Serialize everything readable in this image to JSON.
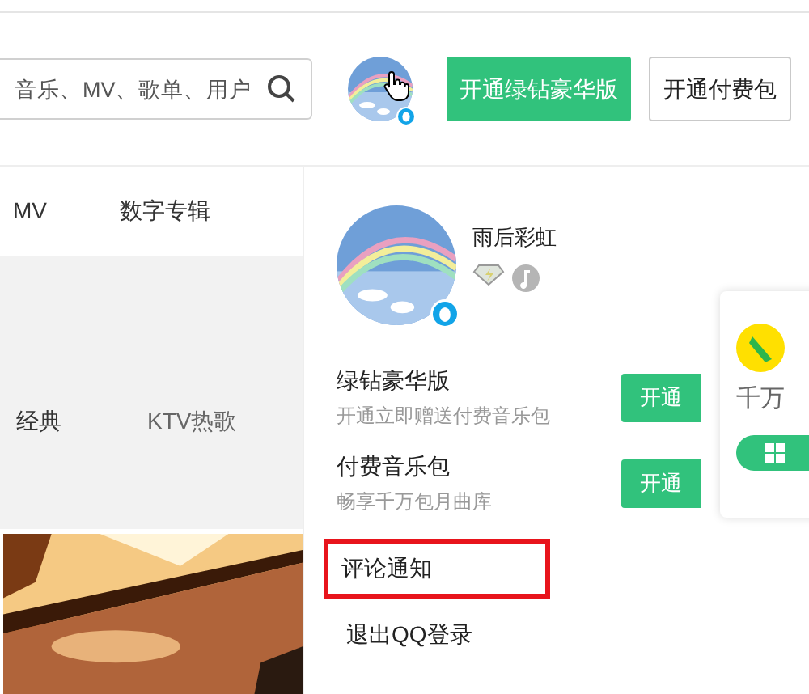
{
  "header": {
    "search": {
      "placeholder": "音乐、MV、歌单、用户"
    },
    "buttons": [
      {
        "label": "开通绿钻豪华版",
        "kind": "primary"
      },
      {
        "label": "开通付费包",
        "kind": "outline"
      }
    ]
  },
  "nav": [
    {
      "label": "MV"
    },
    {
      "label": "数字专辑"
    }
  ],
  "categories": [
    {
      "label": "经典"
    },
    {
      "label": "KTV热歌"
    }
  ],
  "user_menu": {
    "username": "雨后彩虹",
    "offers": [
      {
        "title": "绿钻豪华版",
        "subtitle": "开通立即赠送付费音乐包",
        "button": "开通"
      },
      {
        "title": "付费音乐包",
        "subtitle": "畅享千万包月曲库",
        "button": "开通"
      }
    ],
    "items": [
      {
        "label": "评论通知",
        "highlighted": true
      },
      {
        "label": "退出QQ登录",
        "highlighted": false
      }
    ]
  },
  "popup": {
    "text": "千万"
  }
}
